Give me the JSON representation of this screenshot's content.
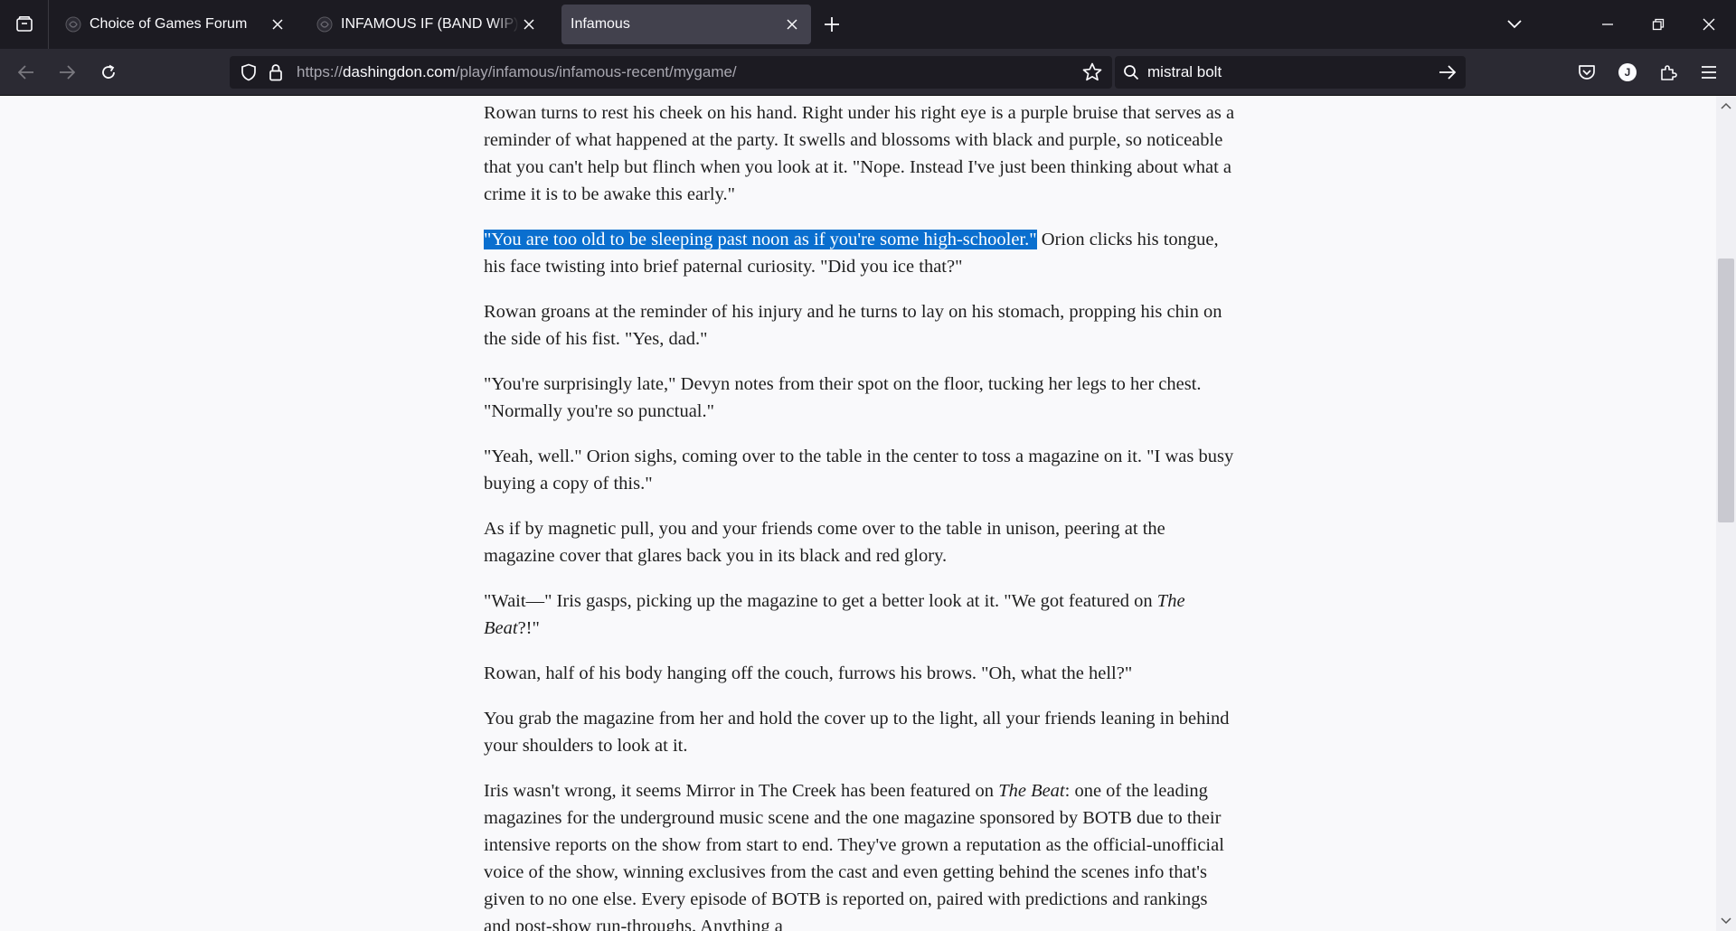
{
  "tabs": [
    {
      "title": "Choice of Games Forum",
      "active": false
    },
    {
      "title": "INFAMOUS IF (BAND WIP) CHAPTER",
      "active": false
    },
    {
      "title": "Infamous",
      "active": true
    }
  ],
  "address": {
    "scheme": "https://",
    "host": "dashingdon.com",
    "path": "/play/infamous/infamous-recent/mygame/"
  },
  "search": {
    "value": "mistral bolt"
  },
  "avatar_initial": "J",
  "scroll": {
    "position_fraction": 0.27,
    "visible_fraction": 0.33
  },
  "colors": {
    "selection": "#0a6fcf",
    "chrome_dark": "#1c1b22",
    "chrome": "#2b2a33",
    "page_bg": "#f9f9fb"
  },
  "story": {
    "p1": "Rowan turns to rest his cheek on his hand. Right under his right eye is a purple bruise that serves as a reminder of what happened at the party. It swells and blossoms with black and purple, so noticeable that you can't help but flinch when you look at it. \"Nope. Instead I've just been thinking about what a crime it is to be awake this early.\"",
    "p2_selected": "\"You are too old to be sleeping past noon as if you're some high-schooler.\"",
    "p2_rest": " Orion clicks his tongue, his face twisting into brief paternal curiosity. \"Did you ice that?\"",
    "p3": "Rowan groans at the reminder of his injury and he turns to lay on his stomach, propping his chin on the side of his fist. \"Yes, dad.\"",
    "p4": "\"You're surprisingly late,\" Devyn notes from their spot on the floor, tucking her legs to her chest. \"Normally you're so punctual.\"",
    "p5": "\"Yeah, well.\" Orion sighs, coming over to the table in the center to toss a magazine on it. \"I was busy buying a copy of this.\"",
    "p6": "As if by magnetic pull, you and your friends come over to the table in unison, peering at the magazine cover that glares back you in its black and red glory.",
    "p7_a": "\"Wait—\" Iris gasps, picking up the magazine to get a better look at it. \"We got featured on ",
    "p7_em": "The Beat",
    "p7_b": "?!\"",
    "p8": "Rowan, half of his body hanging off the couch, furrows his brows. \"Oh, what the hell?\"",
    "p9": "You grab the magazine from her and hold the cover up to the light, all your friends leaning in behind your shoulders to look at it.",
    "p10_a": "Iris wasn't wrong, it seems Mirror in The Creek has been featured on ",
    "p10_em": "The Beat",
    "p10_b": ": one of the leading magazines for the underground music scene and the one magazine sponsored by BOTB due to their intensive reports on the show from start to end. They've grown a reputation as the official-unofficial voice of the show, winning exclusives from the cast and even getting behind the scenes info that's given to no one else. Every episode of BOTB is reported on, paired with predictions and rankings and post-show run-throughs. Anything a"
  }
}
